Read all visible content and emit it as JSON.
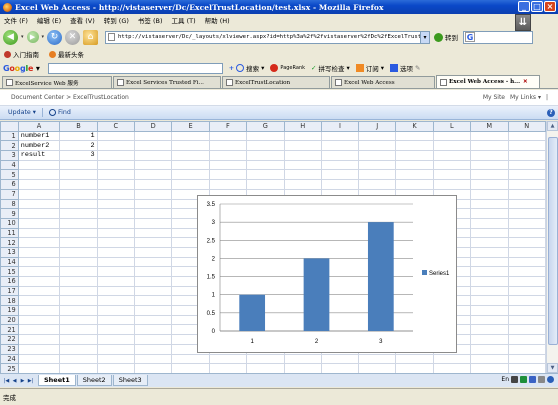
{
  "window": {
    "title": "Excel Web Access - http://vistaserver/Dc/ExcelTrustLocation/test.xlsx - Mozilla Firefox",
    "minimize": "_",
    "maximize": "□",
    "close": "×"
  },
  "menu": [
    "文件 (F)",
    "编辑 (E)",
    "查看 (V)",
    "转到 (G)",
    "书签 (B)",
    "工具 (T)",
    "帮助 (H)"
  ],
  "navbar": {
    "url": "http://vistaserver/Dc/_layouts/xlviewer.aspx?id=http%3a%2f%2fvistaserver%2fDc%2fExcelTrustLocat",
    "go_label": "转到"
  },
  "bookmarks": [
    "入门指南",
    "最新头条"
  ],
  "google_toolbar": {
    "search_label": "搜索",
    "pagerank_label": "PageRank",
    "spell_label": "拼写检查",
    "subscribe_label": "订阅",
    "options_label": "选项"
  },
  "tabs": [
    {
      "label": "ExcelService Web 服务",
      "active": false
    },
    {
      "label": "Excel Services Trusted Fi...",
      "active": false
    },
    {
      "label": "ExcelTrustLocation",
      "active": false
    },
    {
      "label": "Excel Web Access",
      "active": false
    },
    {
      "label": "Excel Web Access - h...",
      "active": true
    }
  ],
  "sharepoint": {
    "breadcrumb": "Document Center  >  ExcelTrustLocation",
    "my_site": "My Site",
    "my_links": "My Links ▾",
    "help": "|"
  },
  "excel_toolbar": {
    "update": "Update ▾",
    "find": "Find",
    "help_icon": "?"
  },
  "grid": {
    "columns": [
      "A",
      "B",
      "C",
      "D",
      "E",
      "F",
      "G",
      "H",
      "I",
      "J",
      "K",
      "L",
      "M",
      "N"
    ],
    "row_numbers": [
      "1",
      "2",
      "3",
      "4",
      "5",
      "6",
      "7",
      "8",
      "9",
      "10",
      "11",
      "12",
      "13",
      "14",
      "15",
      "16",
      "17",
      "18",
      "19",
      "20",
      "21",
      "22",
      "23",
      "24",
      "25"
    ],
    "cells": [
      [
        "number1",
        "1"
      ],
      [
        "number2",
        "2"
      ],
      [
        "result",
        "3"
      ]
    ]
  },
  "chart_data": {
    "type": "bar",
    "categories": [
      "1",
      "2",
      "3"
    ],
    "series": [
      {
        "name": "Series1",
        "values": [
          1,
          2,
          3
        ]
      }
    ],
    "ylim": [
      0,
      3.5
    ],
    "yticks": [
      "0",
      "0.5",
      "1",
      "1.5",
      "2",
      "2.5",
      "3",
      "3.5"
    ],
    "grid": true,
    "legend": "right",
    "color": "#4a7ebb"
  },
  "sheets": [
    {
      "label": "Sheet1",
      "active": true
    },
    {
      "label": "Sheet2",
      "active": false
    },
    {
      "label": "Sheet3",
      "active": false
    }
  ],
  "tray": {
    "lang": "En"
  },
  "status": "完成"
}
